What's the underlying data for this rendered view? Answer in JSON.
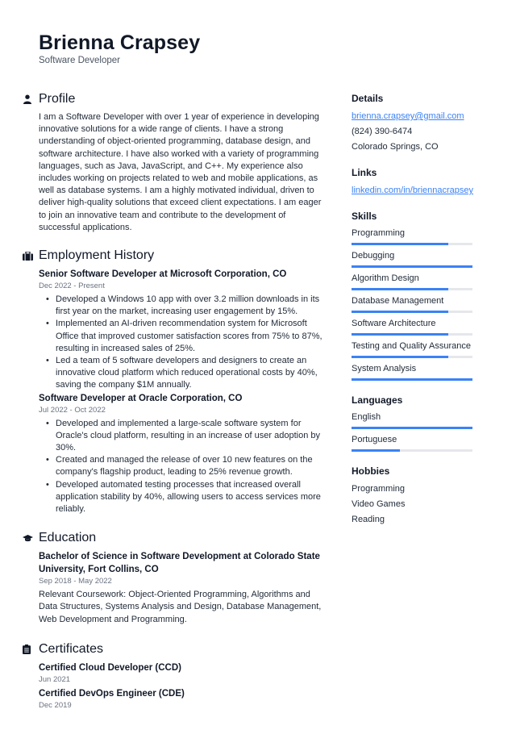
{
  "header": {
    "name": "Brienna Crapsey",
    "role": "Software Developer"
  },
  "profile": {
    "title": "Profile",
    "icon": "user-icon",
    "text": "I am a Software Developer with over 1 year of experience in developing innovative solutions for a wide range of clients. I have a strong understanding of object-oriented programming, database design, and software architecture. I have also worked with a variety of programming languages, such as Java, JavaScript, and C++. My experience also includes working on projects related to web and mobile applications, as well as database systems. I am a highly motivated individual, driven to deliver high-quality solutions that exceed client expectations. I am eager to join an innovative team and contribute to the development of successful applications."
  },
  "employment": {
    "title": "Employment History",
    "icon": "briefcase-icon",
    "jobs": [
      {
        "title": "Senior Software Developer at Microsoft Corporation, CO",
        "date": "Dec 2022 - Present",
        "bullets": [
          "Developed a Windows 10 app with over 3.2 million downloads in its first year on the market, increasing user engagement by 15%.",
          "Implemented an AI-driven recommendation system for Microsoft Office that improved customer satisfaction scores from 75% to 87%, resulting in increased sales of 25%.",
          "Led a team of 5 software developers and designers to create an innovative cloud platform which reduced operational costs by 40%, saving the company $1M annually."
        ]
      },
      {
        "title": "Software Developer at Oracle Corporation, CO",
        "date": "Jul 2022 - Oct 2022",
        "bullets": [
          "Developed and implemented a large-scale software system for Oracle's cloud platform, resulting in an increase of user adoption by 30%.",
          "Created and managed the release of over 10 new features on the company's flagship product, leading to 25% revenue growth.",
          "Developed automated testing processes that increased overall application stability by 40%, allowing users to access services more reliably."
        ]
      }
    ]
  },
  "education": {
    "title": "Education",
    "icon": "graduation-cap-icon",
    "degree": "Bachelor of Science in Software Development at Colorado State University, Fort Collins, CO",
    "date": "Sep 2018 - May 2022",
    "description": "Relevant Coursework: Object-Oriented Programming, Algorithms and Data Structures, Systems Analysis and Design, Database Management, Web Development and Programming."
  },
  "certificates": {
    "title": "Certificates",
    "icon": "clipboard-icon",
    "items": [
      {
        "name": "Certified Cloud Developer (CCD)",
        "date": "Jun 2021"
      },
      {
        "name": "Certified DevOps Engineer (CDE)",
        "date": "Dec 2019"
      }
    ]
  },
  "sidebar": {
    "details": {
      "title": "Details",
      "email": "brienna.crapsey@gmail.com",
      "phone": "(824) 390-6474",
      "location": "Colorado Springs, CO"
    },
    "links": {
      "title": "Links",
      "items": [
        "linkedin.com/in/briennacrapsey"
      ]
    },
    "skills": {
      "title": "Skills",
      "items": [
        {
          "label": "Programming",
          "level": 0.8
        },
        {
          "label": "Debugging",
          "level": 1.0
        },
        {
          "label": "Algorithm Design",
          "level": 0.8
        },
        {
          "label": "Database Management",
          "level": 0.8
        },
        {
          "label": "Software Architecture",
          "level": 0.8
        },
        {
          "label": "Testing and Quality Assurance",
          "level": 0.8
        },
        {
          "label": "System Analysis",
          "level": 1.0
        }
      ]
    },
    "languages": {
      "title": "Languages",
      "items": [
        {
          "label": "English",
          "level": 1.0
        },
        {
          "label": "Portuguese",
          "level": 0.4
        }
      ]
    },
    "hobbies": {
      "title": "Hobbies",
      "items": [
        "Programming",
        "Video Games",
        "Reading"
      ]
    }
  },
  "colors": {
    "accent": "#3b82f6",
    "track": "#e5e7eb",
    "text": "#1f2937",
    "muted": "#6b7280"
  }
}
